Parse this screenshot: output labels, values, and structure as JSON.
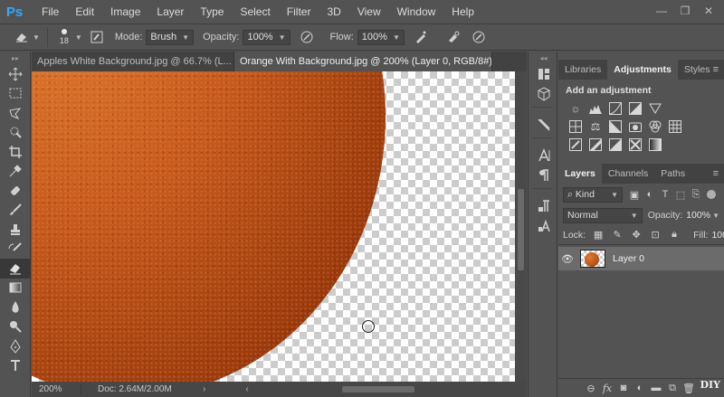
{
  "app": {
    "logo": "Ps"
  },
  "menu": [
    "File",
    "Edit",
    "Image",
    "Layer",
    "Type",
    "Select",
    "Filter",
    "3D",
    "View",
    "Window",
    "Help"
  ],
  "window_controls": {
    "minimize": "—",
    "restore": "❐",
    "close": "✕"
  },
  "options": {
    "brush_size": "18",
    "mode_label": "Mode:",
    "mode_value": "Brush",
    "opacity_label": "Opacity:",
    "opacity_value": "100%",
    "flow_label": "Flow:",
    "flow_value": "100%"
  },
  "tabs": [
    {
      "label": "Apples White Background.jpg @ 66.7% (L...",
      "close": "✕",
      "active": false
    },
    {
      "label": "Orange With Background.jpg @ 200% (Layer 0, RGB/8#) *",
      "close": "✕",
      "active": true
    }
  ],
  "status": {
    "zoom": "200%",
    "doc": "Doc: 2.64M/2.00M",
    "arrow": "›",
    "left_arrow": "‹"
  },
  "adjustments_panel": {
    "tabs": [
      "Libraries",
      "Adjustments",
      "Styles"
    ],
    "active_tab": "Adjustments",
    "title": "Add an adjustment",
    "menu_icon": "≡"
  },
  "layers_panel": {
    "tabs": [
      "Layers",
      "Channels",
      "Paths"
    ],
    "active_tab": "Layers",
    "menu_icon": "≡",
    "kind_label": "Kind",
    "blend_mode": "Normal",
    "opacity_label": "Opacity:",
    "opacity_value": "100%",
    "lock_label": "Lock:",
    "fill_label": "Fill:",
    "fill_value": "100%",
    "layers": [
      {
        "name": "Layer 0",
        "visible": true
      }
    ]
  },
  "watermark": "DIY",
  "colors": {
    "accent": "#31a8ff",
    "orange": "#c75a1d",
    "panel": "#535353"
  }
}
